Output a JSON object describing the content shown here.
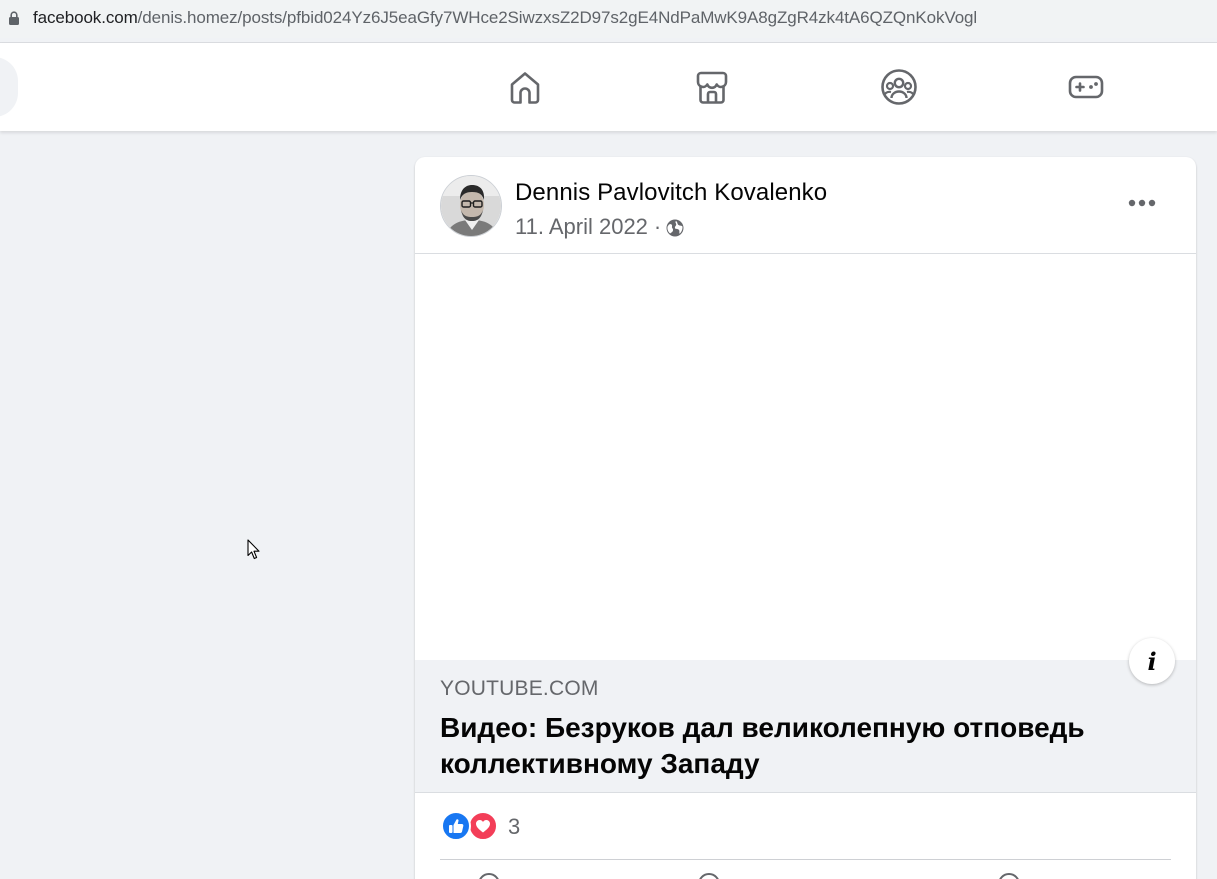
{
  "browser": {
    "url_host": "facebook.com",
    "url_path": "/denis.homez/posts/pfbid024Yz6J5eaGfy7WHce2SiwzxsZ2D97s2gE4NdPaMwK9A8gZgR4zk4tA6QZQnKokVogl"
  },
  "navbar": {
    "tabs": [
      {
        "icon": "home-icon"
      },
      {
        "icon": "marketplace-icon"
      },
      {
        "icon": "groups-icon"
      },
      {
        "icon": "gaming-icon"
      }
    ]
  },
  "post": {
    "author": "Dennis Pavlovitch Kovalenko",
    "date": "11. April 2022",
    "separator": "·",
    "privacy_icon": "globe-icon",
    "link": {
      "domain": "YOUTUBE.COM",
      "title": "Видео: Безруков дал великолепную отповедь коллективному Западу"
    },
    "reactions": {
      "types": [
        "like",
        "love"
      ],
      "count": "3"
    }
  },
  "colors": {
    "background": "#f0f2f5",
    "card": "#ffffff",
    "text_primary": "#050505",
    "text_secondary": "#65676b",
    "like_blue": "#1877f2",
    "love_red": "#f33e58",
    "icon_gray": "#65676b"
  }
}
